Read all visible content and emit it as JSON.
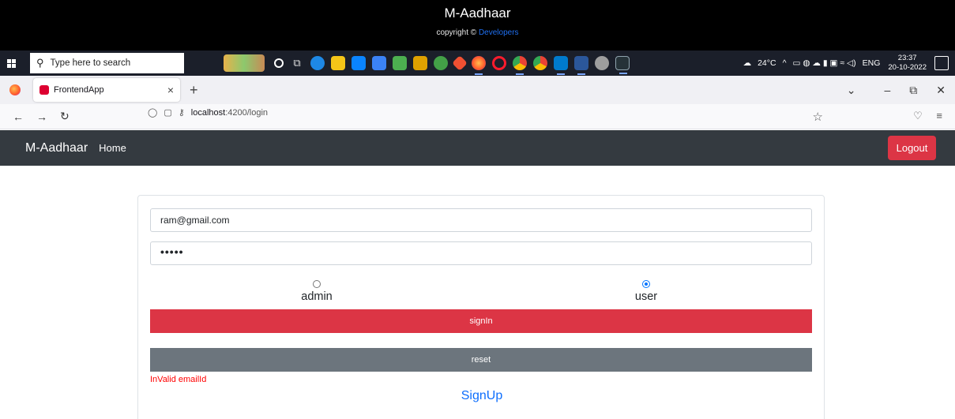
{
  "app_footer": {
    "title": "M-Aadhaar",
    "copyright_text": "copyright ©",
    "copyright_link": "Developers"
  },
  "taskbar": {
    "search_placeholder": "Type here to search",
    "weather": "24°C",
    "language": "ENG",
    "time": "23:37",
    "date": "20-10-2022"
  },
  "browser": {
    "tab_title": "FrontendApp",
    "url_host": "localhost",
    "url_path": ":4200/login"
  },
  "navbar": {
    "brand": "M-Aadhaar",
    "home": "Home",
    "logout": "Logout"
  },
  "login": {
    "email_value": "ram@gmail.com",
    "password_mask": "•••••",
    "radio_admin": "admin",
    "radio_user": "user",
    "selected_role": "user",
    "signin_label": "signIn",
    "reset_label": "reset",
    "error_text": "InValid emailId",
    "signup_label": "SignUp"
  },
  "colors": {
    "danger": "#dc3545",
    "secondary": "#6c757d",
    "dark": "#343a40",
    "link": "#0d6efd",
    "error": "#ff0000"
  }
}
